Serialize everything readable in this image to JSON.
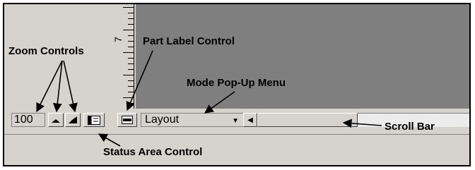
{
  "toolbar": {
    "zoom_value": "100",
    "mode_value": "Layout"
  },
  "ruler": {
    "number": "7"
  },
  "annotations": {
    "zoom_controls": "Zoom Controls",
    "part_label_control": "Part Label Control",
    "mode_popup_menu": "Mode Pop-Up Menu",
    "scroll_bar": "Scroll Bar",
    "status_area_control": "Status Area Control"
  },
  "icons": {
    "zoom_out": "mountain-small-icon",
    "zoom_in": "mountain-large-icon",
    "status_area": "status-area-icon",
    "part_label": "part-label-icon",
    "mode_dropdown": "chevron-down-icon",
    "scroll_left": "triangle-left-icon"
  }
}
